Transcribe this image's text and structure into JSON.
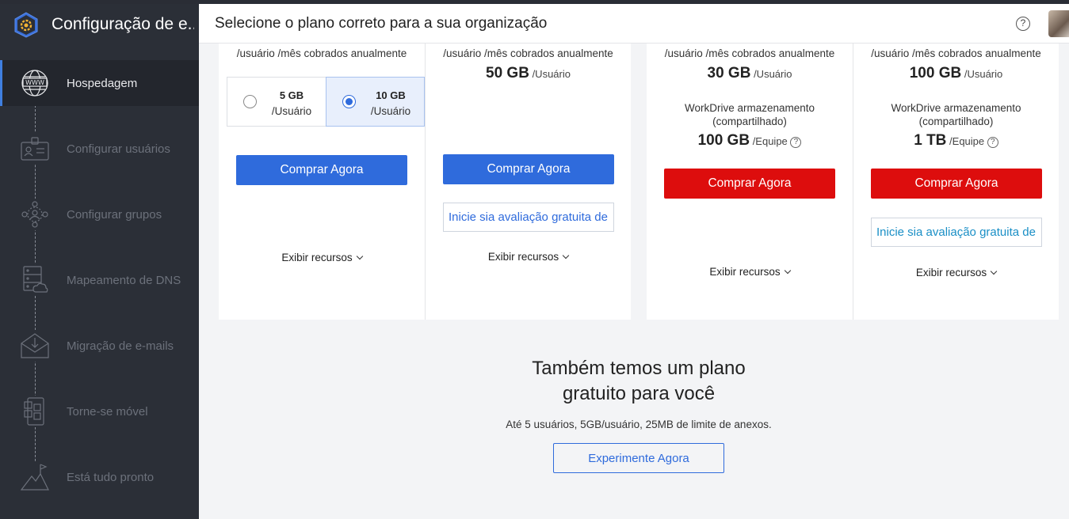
{
  "app": {
    "title": "Configuração de e..."
  },
  "sidebar": {
    "steps": [
      {
        "label": "Hospedagem",
        "icon": "www-globe-icon",
        "active": true
      },
      {
        "label": "Configurar usuários",
        "icon": "user-id-card-icon"
      },
      {
        "label": "Configurar grupos",
        "icon": "group-icon"
      },
      {
        "label": "Mapeamento de DNS",
        "icon": "dns-server-icon"
      },
      {
        "label": "Migração de e-mails",
        "icon": "mail-download-icon"
      },
      {
        "label": "Torne-se móvel",
        "icon": "mobile-icon"
      },
      {
        "label": "Está tudo pronto",
        "icon": "mountain-flag-icon"
      }
    ]
  },
  "header": {
    "title": "Selecione o plano correto para a sua organização",
    "help": "?"
  },
  "plans": [
    {
      "billing": "/usuário /mês cobrados anualmente",
      "options": [
        {
          "size": "5 GB",
          "unit": "/Usuário",
          "selected": false
        },
        {
          "size": "10 GB",
          "unit": "/Usuário",
          "selected": true
        }
      ],
      "buy": "Comprar Agora",
      "features": "Exibir recursos"
    },
    {
      "billing": "/usuário /mês cobrados anualmente",
      "storage": "50 GB",
      "storage_unit": "/Usuário",
      "buy": "Comprar Agora",
      "trial": "Inicie sia avaliação gratuita de",
      "features": "Exibir recursos"
    },
    {
      "billing": "/usuário /mês cobrados anualmente",
      "storage": "30 GB",
      "storage_unit": "/Usuário",
      "workdrive_line1": "WorkDrive armazenamento",
      "workdrive_line2": "(compartilhado)",
      "workdrive": "100 GB",
      "workdrive_unit": "/Equipe",
      "buy": "Comprar Agora",
      "features": "Exibir recursos"
    },
    {
      "billing": "/usuário /mês cobrados anualmente",
      "storage": "100 GB",
      "storage_unit": "/Usuário",
      "workdrive_line1": "WorkDrive armazenamento",
      "workdrive_line2": "(compartilhado)",
      "workdrive": "1 TB",
      "workdrive_unit": "/Equipe",
      "buy": "Comprar Agora",
      "trial": "Inicie sia avaliação gratuita de",
      "features": "Exibir recursos"
    }
  ],
  "free": {
    "title_line1": "Também temos um plano",
    "title_line2": "gratuito para você",
    "subtitle": "Até 5 usuários, 5GB/usuário, 25MB de limite de anexos.",
    "button": "Experimente Agora"
  },
  "colors": {
    "primary": "#2f6bdc",
    "buy_red": "#dd0d0d",
    "sidebar": "#2b2f37"
  }
}
